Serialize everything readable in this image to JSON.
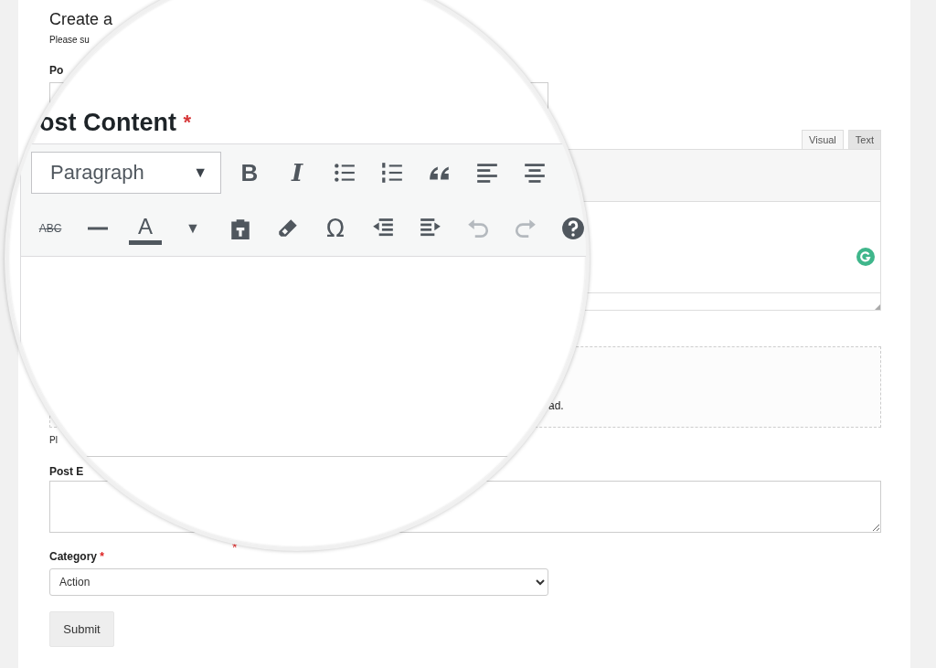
{
  "form": {
    "title": "Create a",
    "description": "Please su",
    "title_label": "Po",
    "editor_tabs": [
      {
        "label": "Visual",
        "selected": true
      },
      {
        "label": "Text",
        "selected": false
      }
    ],
    "upload_text": "ad.",
    "upload_hint": "Pl",
    "excerpt_label": "Post E",
    "stray_required": "*",
    "category_label": "Category",
    "category_required": "*",
    "category_value": "Action",
    "submit": "Submit"
  },
  "magnifier": {
    "heading": "ost Content",
    "required": "*",
    "format_select": {
      "value": "Paragraph",
      "caret": "▼"
    },
    "toolbar_rows": [
      [
        {
          "kind": "bold",
          "text": "B",
          "disabled": false
        },
        {
          "kind": "italic",
          "text": "I",
          "disabled": false
        },
        {
          "kind": "icon",
          "disabled": false
        },
        {
          "kind": "icon",
          "disabled": false
        },
        {
          "kind": "icon",
          "disabled": false
        },
        {
          "kind": "icon",
          "disabled": false
        },
        {
          "kind": "icon",
          "disabled": false
        }
      ],
      [
        {
          "kind": "strike",
          "text": "ABC",
          "disabled": false
        },
        {
          "kind": "icon",
          "disabled": false
        },
        {
          "kind": "textcolor",
          "text": "A",
          "disabled": false
        },
        {
          "kind": "caret",
          "text": "▼",
          "disabled": false
        },
        {
          "kind": "icon",
          "disabled": false
        },
        {
          "kind": "icon",
          "disabled": false
        },
        {
          "kind": "symbol",
          "text": "Ω",
          "disabled": false
        },
        {
          "kind": "icon",
          "disabled": false
        },
        {
          "kind": "icon",
          "disabled": false
        },
        {
          "kind": "icon",
          "disabled": true
        },
        {
          "kind": "icon",
          "disabled": true
        },
        {
          "kind": "icon",
          "disabled": false
        }
      ]
    ]
  }
}
